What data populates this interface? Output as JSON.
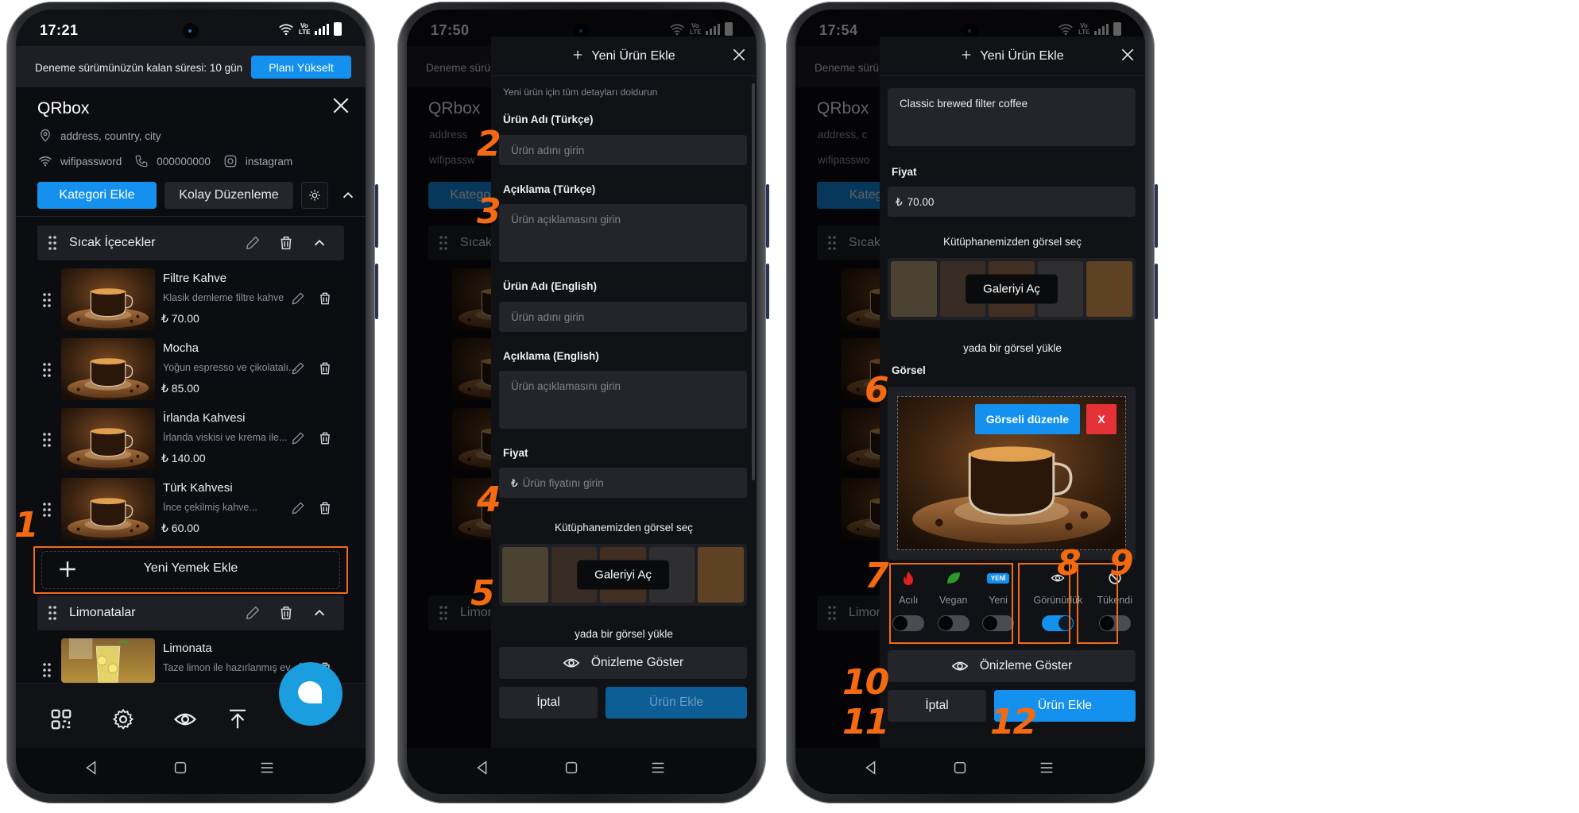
{
  "colors": {
    "accent": "#1491ee",
    "annotation": "#f56a10",
    "danger": "#e53238",
    "background": "#0c0d10",
    "fab": "#1a9ee0"
  },
  "phones": [
    {
      "status": {
        "time": "17:21",
        "volte": "Vo LTE"
      },
      "trial_banner": {
        "text": "Deneme sürümünüzün kalan süresi: 10 gün",
        "upgrade_button": "Planı Yükselt"
      },
      "header": {
        "title": "QRbox",
        "address": "address, country, city",
        "wifi": "wifipassword",
        "phone": "000000000",
        "instagram": "instagram"
      },
      "actions": {
        "add_category": "Kategori Ekle",
        "easy_edit": "Kolay Düzenleme"
      },
      "categories": [
        {
          "name": "Sıcak İçecekler",
          "items": [
            {
              "name": "Filtre Kahve",
              "description": "Klasik demleme filtre kahve",
              "price": "₺ 70.00"
            },
            {
              "name": "Mocha",
              "description": "Yoğun espresso ve çikolatalı...",
              "price": "₺ 85.00"
            },
            {
              "name": "İrlanda Kahvesi",
              "description": "İrlanda viskisi ve krema ile...",
              "price": "₺ 140.00"
            },
            {
              "name": "Türk Kahvesi",
              "description": "İnce çekilmiş kahve...",
              "price": "₺ 60.00"
            }
          ],
          "add_item_label": "Yeni Yemek Ekle"
        },
        {
          "name": "Limonatalar",
          "items": [
            {
              "name": "Limonata",
              "description": "Taze limon ile hazırlanmış ev...",
              "price": ""
            }
          ]
        }
      ],
      "bottom_nav": [
        "qr-code-icon",
        "gear-icon",
        "eye-icon",
        "scroll-top-icon",
        "chat-icon"
      ],
      "annotations": [
        "1"
      ]
    },
    {
      "status": {
        "time": "17:50",
        "volte": "Vo LTE"
      },
      "background_dimmed": {
        "trial_text": "Deneme sürümü",
        "title": "QRbox",
        "address": "address",
        "wifi": "wifipassw",
        "add_category": "Kategori Ekle",
        "category": "Sıcak İç",
        "category2": "Limonat"
      },
      "drawer": {
        "title": "Yeni Ürün Ekle",
        "subtitle": "Yeni ürün için tüm detayları doldurun",
        "name_tr_label": "Ürün Adı (Türkçe)",
        "name_tr_placeholder": "Ürün adını girin",
        "desc_tr_label": "Açıklama (Türkçe)",
        "desc_tr_placeholder": "Ürün açıklamasını girin",
        "name_en_label": "Ürün Adı (English)",
        "name_en_placeholder": "Ürün adını girin",
        "desc_en_label": "Açıklama (English)",
        "desc_en_placeholder": "Ürün açıklamasını girin",
        "price_label": "Fiyat",
        "currency": "₺",
        "price_placeholder": "Ürün fiyatını girin",
        "library_label": "Kütüphanemizden görsel seç",
        "gallery_button": "Galeriyi Aç",
        "upload_label": "yada bir görsel yükle",
        "preview_button": "Önizleme Göster",
        "cancel_button": "İptal",
        "submit_button": "Ürün Ekle"
      },
      "annotations": [
        "2",
        "3",
        "4",
        "5"
      ]
    },
    {
      "status": {
        "time": "17:54",
        "volte": "Vo LTE"
      },
      "background_dimmed": {
        "trial_text": "Deneme sürüm",
        "title": "QRbox",
        "address": "address, c",
        "wifi": "wifipasswo",
        "add_category": "Kategori I",
        "category": "Sıcak İç",
        "category2": "Limonat"
      },
      "drawer": {
        "title": "Yeni Ürün Ekle",
        "description_value": "Classic brewed filter coffee",
        "price_label": "Fiyat",
        "currency": "₺",
        "price_value": "70.00",
        "library_label": "Kütüphanemizden görsel seç",
        "gallery_button": "Galeriyi Aç",
        "upload_label": "yada bir görsel yükle",
        "image_label": "Görsel",
        "edit_image_button": "Görseli düzenle",
        "remove_image_button": "X",
        "tags": [
          {
            "label": "Acılı",
            "icon": "flame-icon",
            "on": false
          },
          {
            "label": "Vegan",
            "icon": "leaf-icon",
            "on": false
          },
          {
            "label": "Yeni",
            "icon": "new-badge",
            "badge": "YENİ",
            "on": false
          }
        ],
        "visibility": {
          "label": "Görünürlük",
          "on": true
        },
        "sold_out": {
          "label": "Tükendi",
          "on": false
        },
        "preview_button": "Önizleme Göster",
        "cancel_button": "İptal",
        "submit_button": "Ürün Ekle"
      },
      "annotations": [
        "6",
        "7",
        "8",
        "9",
        "10",
        "11",
        "12"
      ]
    }
  ]
}
